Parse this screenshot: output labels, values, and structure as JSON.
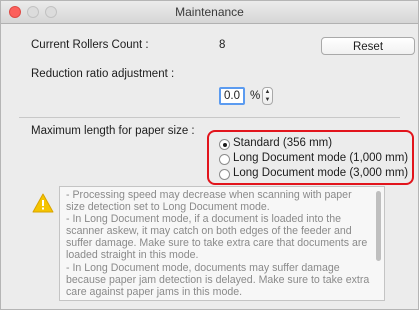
{
  "window": {
    "title": "Maintenance"
  },
  "rollers": {
    "label": "Current Rollers Count :",
    "value": "8",
    "reset_label": "Reset"
  },
  "reduction": {
    "label": "Reduction ratio adjustment :",
    "value": "0.0",
    "unit": "%"
  },
  "paper": {
    "label": "Maximum length for paper size :",
    "options": [
      {
        "label": "Standard (356 mm)",
        "selected": true
      },
      {
        "label": "Long Document mode (1,000 mm)",
        "selected": false
      },
      {
        "label": "Long Document mode (3,000 mm)",
        "selected": false
      }
    ]
  },
  "note": {
    "icon": "warning-icon",
    "text": "- Processing speed may decrease when scanning with paper size detection set to Long Document mode.\n- In Long Document mode, if a document is loaded into the scanner askew, it may catch on both edges of the feeder and suffer damage. Make sure to take extra care that documents are loaded straight in this mode.\n- In Long Document mode, documents may suffer damage because paper jam detection is delayed. Make sure to take extra care against paper jams in this mode."
  },
  "colors": {
    "highlight": "#e2141c",
    "focus": "#5b9bf0",
    "warning": "#f5c400"
  }
}
